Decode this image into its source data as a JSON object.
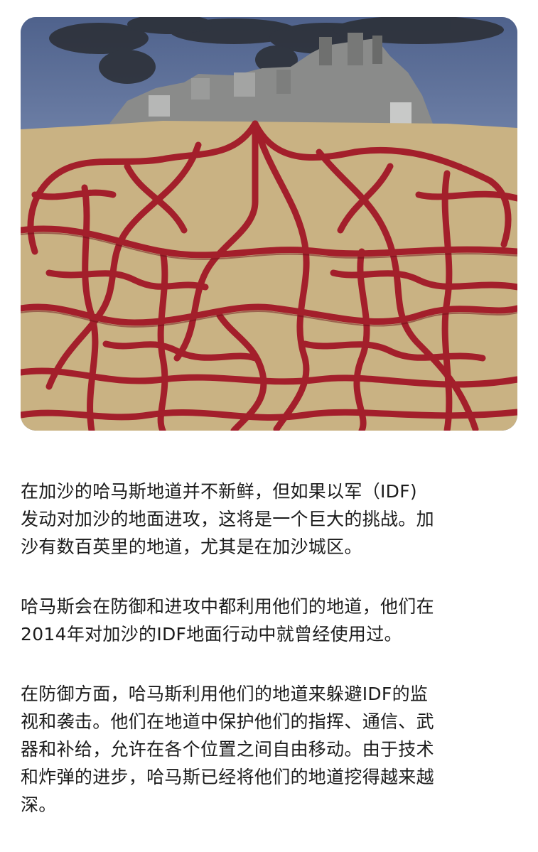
{
  "image": {
    "subject": "illustration",
    "palette": {
      "sky": "#5b6e98",
      "sand": "#c9b283",
      "tunnel": "#a31f2b",
      "smoke": "#2a2d33",
      "city": "#8a8b8a"
    }
  },
  "article": {
    "paragraphs": [
      "在加沙的哈马斯地道并不新鲜，但如果以军（IDF)\n发动对加沙的地面进攻，这将是一个巨大的挑战。加\n沙有数百英里的地道，尤其是在加沙城区。",
      "哈马斯会在防御和进攻中都利用他们的地道，他们在\n2014年对加沙的IDF地面行动中就曾经使用过。",
      "在防御方面，哈马斯利用他们的地道来躲避IDF的监\n视和袭击。他们在地道中保护他们的指挥、通信、武\n器和补给，允许在各个位置之间自由移动。由于技术\n和炸弹的进步，哈马斯已经将他们的地道挖得越来越\n深。"
    ]
  }
}
